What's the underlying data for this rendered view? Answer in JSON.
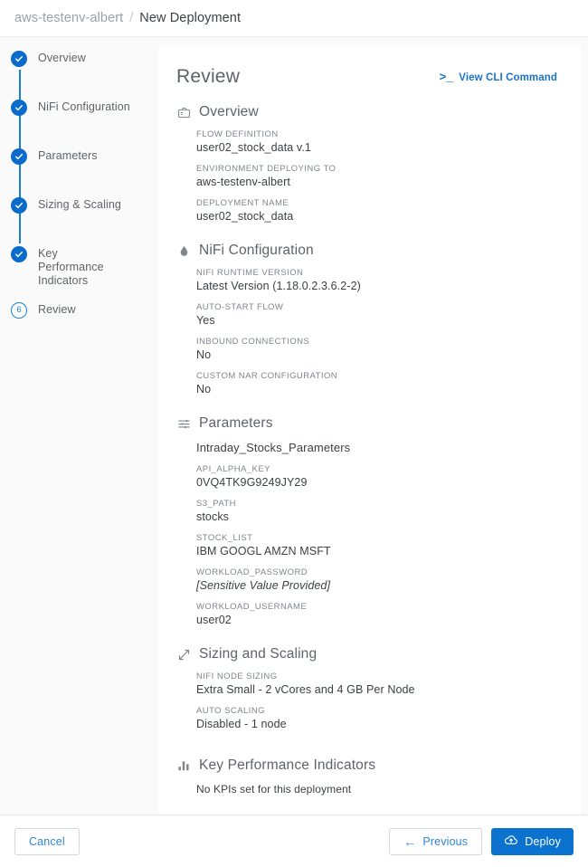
{
  "breadcrumb": {
    "parent": "aws-testenv-albert",
    "separator": "/",
    "current": "New Deployment"
  },
  "stepper": {
    "steps": [
      {
        "label": "Overview",
        "state": "done",
        "number": "1"
      },
      {
        "label": "NiFi Configuration",
        "state": "done",
        "number": "2"
      },
      {
        "label": "Parameters",
        "state": "done",
        "number": "3"
      },
      {
        "label": "Sizing & Scaling",
        "state": "done",
        "number": "4"
      },
      {
        "label": "Key Performance Indicators",
        "state": "done",
        "number": "5"
      },
      {
        "label": "Review",
        "state": "current",
        "number": "6"
      }
    ]
  },
  "main": {
    "title": "Review",
    "cli_link": {
      "prompt": ">_",
      "label": "View CLI Command"
    },
    "sections": [
      {
        "id": "overview",
        "icon": "briefcase-icon",
        "title": "Overview",
        "fields": [
          {
            "label": "FLOW DEFINITION",
            "value": "user02_stock_data v.1"
          },
          {
            "label": "ENVIRONMENT DEPLOYING TO",
            "value": "aws-testenv-albert"
          },
          {
            "label": "DEPLOYMENT NAME",
            "value": "user02_stock_data"
          }
        ]
      },
      {
        "id": "nifi-configuration",
        "icon": "water-droplet-icon",
        "title": "NiFi Configuration",
        "fields": [
          {
            "label": "NIFI RUNTIME VERSION",
            "value": "Latest Version (1.18.0.2.3.6.2-2)"
          },
          {
            "label": "AUTO-START FLOW",
            "value": "Yes"
          },
          {
            "label": "INBOUND CONNECTIONS",
            "value": "No"
          },
          {
            "label": "CUSTOM NAR CONFIGURATION",
            "value": "No"
          }
        ]
      },
      {
        "id": "parameters",
        "icon": "sliders-icon",
        "title": "Parameters",
        "set_name": "Intraday_Stocks_Parameters",
        "fields": [
          {
            "label": "API_ALPHA_KEY",
            "value": "0VQ4TK9G9249JY29"
          },
          {
            "label": "S3_PATH",
            "value": "stocks"
          },
          {
            "label": "STOCK_LIST",
            "value": "IBM GOOGL AMZN MSFT"
          },
          {
            "label": "WORKLOAD_PASSWORD",
            "value": "[Sensitive Value Provided]",
            "sensitive": true
          },
          {
            "label": "WORKLOAD_USERNAME",
            "value": "user02"
          }
        ]
      },
      {
        "id": "sizing-and-scaling",
        "icon": "resize-arrows-icon",
        "title": "Sizing and Scaling",
        "fields": [
          {
            "label": "NIFI NODE SIZING",
            "value": "Extra Small - 2 vCores and 4 GB Per Node"
          },
          {
            "label": "AUTO SCALING",
            "value": "Disabled - 1 node"
          }
        ]
      },
      {
        "id": "key-performance-indicators",
        "icon": "bar-chart-icon",
        "title": "Key Performance Indicators",
        "empty_text": "No KPIs set for this deployment"
      }
    ]
  },
  "footer": {
    "cancel_label": "Cancel",
    "previous_label": "Previous",
    "deploy_label": "Deploy"
  },
  "colors": {
    "accent_blue": "#0b72cf",
    "step_blue": "#1b7fd6",
    "link_blue": "#1a73c7",
    "text_gray": "#5f6368",
    "label_gray": "#80868b",
    "page_bg": "#fafafa"
  }
}
